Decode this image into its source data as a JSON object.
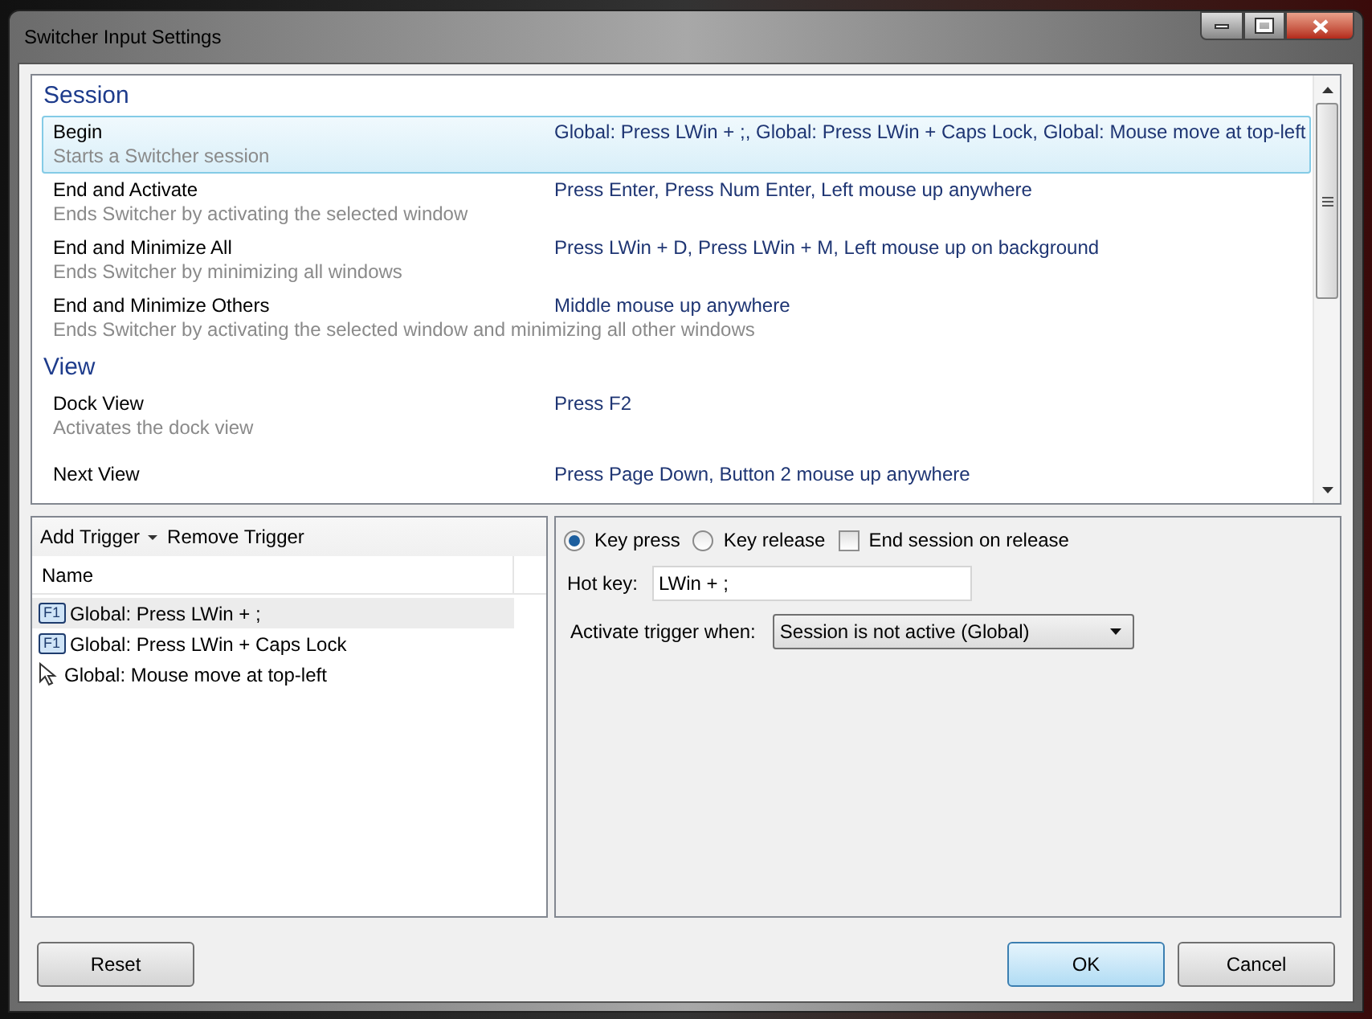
{
  "window": {
    "title": "Switcher Input Settings"
  },
  "sections": [
    {
      "title": "Session",
      "items": [
        {
          "name": "Begin",
          "description": "Starts a Switcher session",
          "triggers": "Global: Press LWin + ;, Global: Press LWin + Caps Lock, Global: Mouse move at top-left",
          "selected": true
        },
        {
          "name": "End and Activate",
          "description": "Ends Switcher by activating the selected window",
          "triggers": "Press Enter, Press Num Enter, Left mouse up anywhere",
          "selected": false
        },
        {
          "name": "End and Minimize All",
          "description": "Ends Switcher by minimizing all windows",
          "triggers": "Press LWin + D, Press LWin + M, Left mouse up on background",
          "selected": false
        },
        {
          "name": "End and Minimize Others",
          "description": "Ends Switcher by activating the selected window and minimizing all other windows",
          "triggers": "Middle mouse up anywhere",
          "selected": false
        }
      ]
    },
    {
      "title": "View",
      "items": [
        {
          "name": "Dock View",
          "description": "Activates the dock view",
          "triggers": "Press F2",
          "selected": false
        },
        {
          "name": "Next View",
          "triggers": "Press Page Down, Button 2 mouse up anywhere",
          "selected": false
        }
      ]
    }
  ],
  "toolbar": {
    "add_trigger": "Add Trigger",
    "remove_trigger": "Remove Trigger"
  },
  "trigger_table": {
    "columns": [
      "Name"
    ],
    "rows": [
      {
        "kind": "key",
        "key_label": "F1",
        "text": "Global: Press LWin + ;",
        "selected": true
      },
      {
        "kind": "key",
        "key_label": "F1",
        "text": "Global: Press LWin + Caps Lock",
        "selected": false
      },
      {
        "kind": "mouse",
        "text": "Global: Mouse move at top-left",
        "selected": false
      }
    ]
  },
  "trigger_options": {
    "radios": [
      {
        "label": "Key press",
        "selected": true
      },
      {
        "label": "Key release",
        "selected": false
      }
    ],
    "end_session": {
      "label": "End session on release",
      "checked": false
    },
    "hot_key": {
      "label": "Hot key:",
      "value": "LWin + ;"
    },
    "activate_when": {
      "label": "Activate trigger when:",
      "value": "Session is not active (Global)"
    }
  },
  "buttons": {
    "left": [
      {
        "label": "Reset",
        "default": false
      }
    ],
    "right": [
      {
        "label": "OK",
        "default": true
      },
      {
        "label": "Cancel",
        "default": false
      }
    ]
  }
}
